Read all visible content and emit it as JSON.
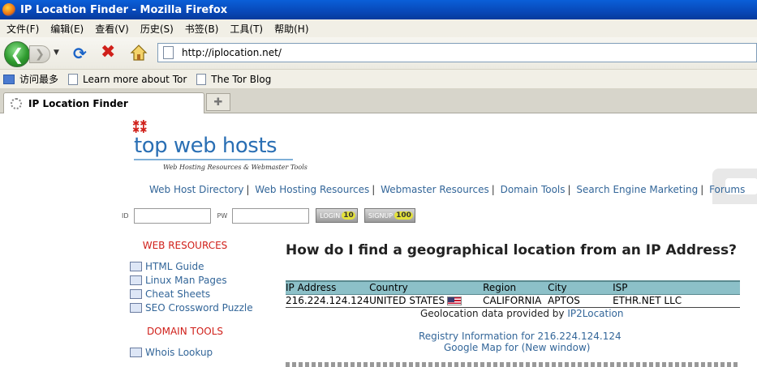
{
  "window": {
    "title": "IP Location Finder - Mozilla Firefox"
  },
  "menu": [
    "文件(F)",
    "编辑(E)",
    "查看(V)",
    "历史(S)",
    "书签(B)",
    "工具(T)",
    "帮助(H)"
  ],
  "nav": {
    "url": "http://iplocation.net/"
  },
  "bookmarks": [
    "访问最多",
    "Learn more about Tor",
    "The Tor Blog"
  ],
  "tab": {
    "title": "IP Location Finder"
  },
  "site": {
    "brand": "top web hosts",
    "tagline": "Web Hosting Resources & Webmaster Tools",
    "topnav": [
      "Web Host Directory",
      "Web Hosting Resources",
      "Webmaster Resources",
      "Domain Tools",
      "Search Engine Marketing",
      "Forums"
    ],
    "login": {
      "id_label": "ID",
      "pw_label": "PW",
      "login_label": "LOGIN",
      "login_badge": "10",
      "signup_label": "SIGNUP",
      "signup_badge": "100"
    },
    "sidebar": {
      "web_heading": "WEB RESOURCES",
      "web_items": [
        "HTML Guide",
        "Linux Man Pages",
        "Cheat Sheets",
        "SEO Crossword Puzzle"
      ],
      "domain_heading": "DOMAIN TOOLS",
      "domain_items": [
        "Whois Lookup"
      ]
    }
  },
  "main": {
    "title": "How do I find a geographical location from an IP Address?",
    "table": {
      "headers": [
        "IP Address",
        "Country",
        "Region",
        "City",
        "ISP"
      ],
      "row": [
        "216.224.124.124",
        "UNITED STATES",
        "CALIFORNIA",
        "APTOS",
        "ETHR.NET LLC"
      ]
    },
    "provided_text": "Geolocation data provided by",
    "provided_link": "IP2Location",
    "registry_link": "Registry Information for 216.224.124.124",
    "gmap_link": "Google Map for (New window)"
  }
}
